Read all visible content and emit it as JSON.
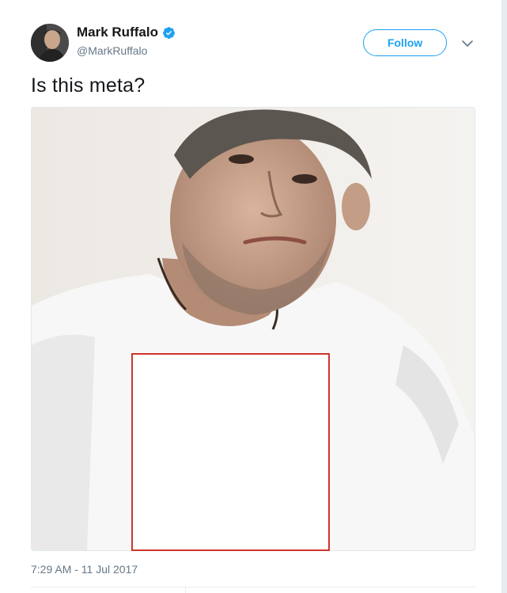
{
  "tweet": {
    "author": {
      "name": "Mark Ruffalo",
      "handle": "@MarkRuffalo",
      "verified": true,
      "avatar_icon": "profile-photo"
    },
    "follow_label": "Follow",
    "menu_icon": "chevron-down-icon",
    "text": "Is this meta?",
    "media": {
      "description_icon": "photo",
      "redaction": "red-outlined-white-square"
    },
    "timestamp": "7:29 AM - 11 Jul 2017"
  },
  "colors": {
    "brand": "#1da1f2",
    "text": "#14171a",
    "muted": "#657786",
    "redaction_border": "#d0342c"
  }
}
